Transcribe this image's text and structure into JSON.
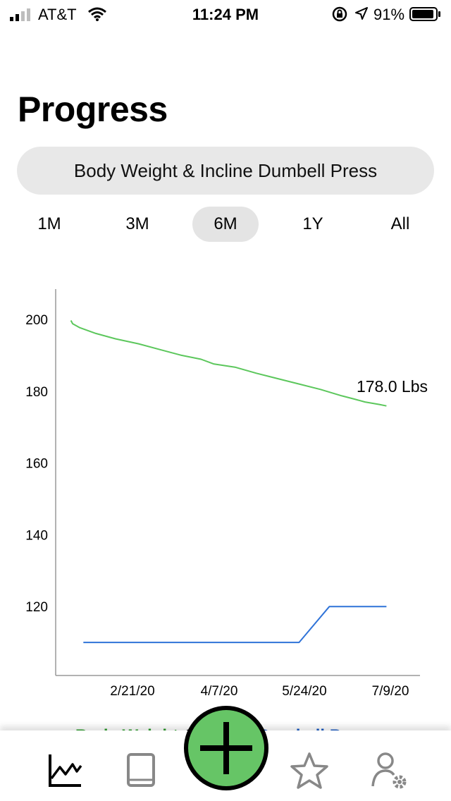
{
  "status_bar": {
    "carrier": "AT&T",
    "time": "11:24 PM",
    "battery_percent": "91%",
    "icons": [
      "signal-icon",
      "wifi-icon",
      "orientation-lock-icon",
      "location-arrow-icon",
      "battery-icon"
    ]
  },
  "page": {
    "title": "Progress"
  },
  "selector": {
    "label": "Body Weight & Incline Dumbell Press"
  },
  "ranges": {
    "items": [
      "1M",
      "3M",
      "6M",
      "1Y",
      "All"
    ],
    "selected": "6M"
  },
  "chart_data": {
    "type": "line",
    "title": "",
    "xlabel": "",
    "ylabel": "",
    "ylim": [
      100,
      210
    ],
    "x_ticks": [
      "2/21/20",
      "4/7/20",
      "5/24/20",
      "7/9/20"
    ],
    "y_ticks": [
      200,
      180,
      160,
      140,
      120
    ],
    "annotation": "178.0 Lbs",
    "series": [
      {
        "color": "#5cc75c",
        "x": [
          "2020-01-18",
          "2020-01-19",
          "2020-01-23",
          "2020-02-01",
          "2020-02-12",
          "2020-02-25",
          "2020-03-08",
          "2020-03-20",
          "2020-03-31",
          "2020-04-07",
          "2020-04-19",
          "2020-05-01",
          "2020-05-13",
          "2020-05-25",
          "2020-06-06",
          "2020-06-18",
          "2020-06-25",
          "2020-07-01",
          "2020-07-09",
          "2020-07-13"
        ],
        "y": [
          199.7,
          198.8,
          197.7,
          196.1,
          194.6,
          193.2,
          191.6,
          190.0,
          188.9,
          187.6,
          186.7,
          185.0,
          183.5,
          182.0,
          180.5,
          178.7,
          177.8,
          177.0,
          176.3,
          175.9
        ]
      },
      {
        "color": "#2f73d8",
        "x": [
          "2020-01-25",
          "2020-05-25",
          "2020-06-11",
          "2020-07-13"
        ],
        "y": [
          110,
          110,
          120,
          120
        ]
      }
    ]
  },
  "legend_peek": {
    "green_text": "Body Weight",
    "blue_text": "Incline Dumbell Press"
  },
  "tabbar": {
    "items": [
      "chart-icon",
      "book-icon",
      "add-icon",
      "star-icon",
      "profile-settings-icon"
    ]
  }
}
